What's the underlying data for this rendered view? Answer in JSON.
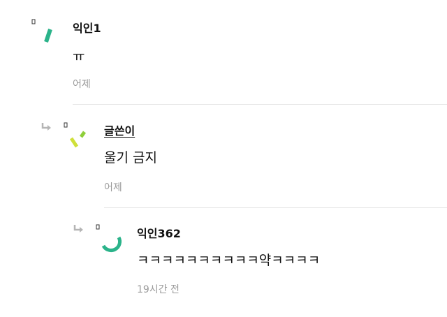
{
  "comments": [
    {
      "author": "익인1",
      "body": "ㅠ",
      "time": "어제",
      "is_reply": false,
      "avatar_color": "#2bb38a"
    },
    {
      "author": "글쓴이",
      "body": "울기 금지",
      "time": "어제",
      "is_reply": true,
      "is_op": true,
      "avatar_colors": [
        "#cfe03a",
        "#8fcf3a"
      ]
    },
    {
      "author": "익인362",
      "body": "ㅋㅋㅋㅋㅋㅋㅋㅋㅋㅋ약ㅋㅋㅋㅋ",
      "time": "19시간 전",
      "is_reply": true,
      "avatar_color": "#2bb38a"
    }
  ],
  "icons": {
    "reply": "reply-arrow-icon",
    "avatar": "anonymous-avatar-icon"
  }
}
